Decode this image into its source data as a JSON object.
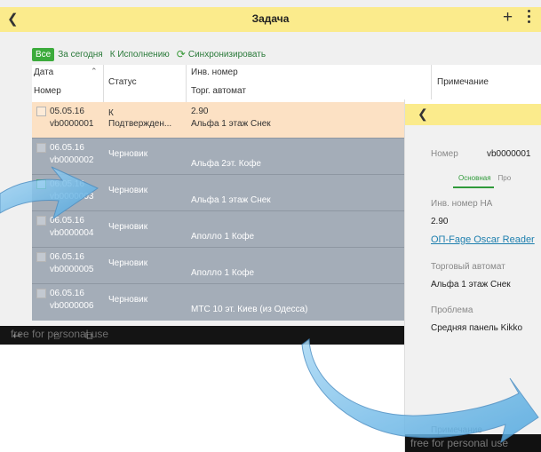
{
  "app": {
    "title": "Задача",
    "back_icon": "back-arrow-icon",
    "plus_label": "+",
    "menu_icon": "kebab-menu-icon",
    "accent": "#fbeb8c"
  },
  "filters": {
    "all": "Все",
    "today": "За сегодня",
    "to_execute": "К Исполнению",
    "sync": "Синхронизировать",
    "active_color": "#3cab3c"
  },
  "columns": {
    "date": "Дата",
    "number": "Номер",
    "status": "Статус",
    "inv": "Инв. номер",
    "vending": "Торг. автомат",
    "note": "Примечание"
  },
  "rows": [
    {
      "date": "05.05.16",
      "number": "vb0000001",
      "status": "К Подтвержден...",
      "inv": "2.90",
      "vending": "Альфа 1 этаж Снек"
    },
    {
      "date": "06.05.16",
      "number": "vb0000002",
      "status": "Черновик",
      "inv": "",
      "vending": "Альфа 2эт. Кофе"
    },
    {
      "date": "06.05.16",
      "number": "vb0000003",
      "status": "Черновик",
      "inv": "",
      "vending": "Альфа 1 этаж Снек"
    },
    {
      "date": "06.05.16",
      "number": "vb0000004",
      "status": "Черновик",
      "inv": "",
      "vending": "Аполло 1 Кофе"
    },
    {
      "date": "06.05.16",
      "number": "vb0000005",
      "status": "Черновик",
      "inv": "",
      "vending": "Аполло 1 Кофе"
    },
    {
      "date": "06.05.16",
      "number": "vb0000006",
      "status": "Черновик",
      "inv": "",
      "vending": "МТС 10 эт. Киев (из Одесса)"
    }
  ],
  "status_first_line": "К",
  "status_first_second": "Подтвержден...",
  "row_colors": {
    "highlight": "#fce1c4",
    "normal": "#a4adb8"
  },
  "watermark": "free for personal use",
  "detail": {
    "number_label": "Номер",
    "number_value": "vb0000001",
    "tab_main": "Основная",
    "tab_other": "Про",
    "inv_label": "Инв. номер НА",
    "inv_value": "2.90",
    "link": "ОП-Fage Oscar Reader",
    "vending_label": "Торговый автомат",
    "vending_value": "Альфа 1 этаж Снек",
    "problem_label": "Проблема",
    "problem_value": "Средняя панель Kikko",
    "note_label": "Примечание"
  }
}
